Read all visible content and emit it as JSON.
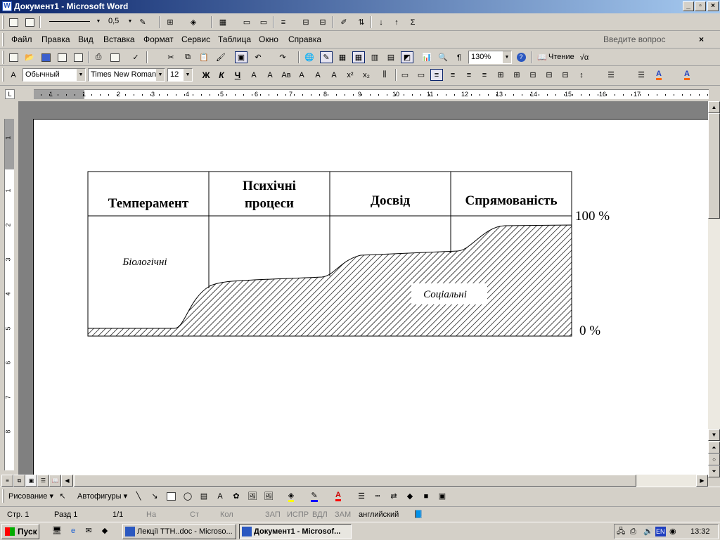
{
  "window": {
    "title": "Документ1 - Microsoft Word"
  },
  "menubar": {
    "items": [
      "Файл",
      "Правка",
      "Вид",
      "Вставка",
      "Формат",
      "Сервис",
      "Таблица",
      "Окно",
      "Справка"
    ],
    "help_placeholder": "Введите вопрос"
  },
  "toolbar_top": {
    "line_weight": "0,5"
  },
  "toolbar_standard": {
    "zoom": "130%",
    "reading_label": "Чтение"
  },
  "toolbar_format": {
    "style": "Обычный",
    "font": "Times New Roman",
    "size": "12",
    "bold": "Ж",
    "italic": "К",
    "underline": "Ч"
  },
  "ruler": {
    "h_numbers": [
      "1",
      "1",
      "2",
      "3",
      "4",
      "5",
      "6",
      "7",
      "8",
      "9",
      "10",
      "11",
      "12",
      "13",
      "14",
      "15",
      "16",
      "17"
    ],
    "v_numbers": [
      "1",
      "1",
      "2",
      "3",
      "4",
      "5",
      "6",
      "7",
      "8"
    ]
  },
  "document": {
    "table_headers": [
      "Темперамент",
      "Психічні процеси",
      "Досвід",
      "Спрямованість"
    ],
    "label_bio": "Біологічні",
    "label_soc": "Соціальні",
    "pct_top": "100 %",
    "pct_bottom": "0 %"
  },
  "drawbar": {
    "drawing": "Рисование",
    "autoshapes": "Автофигуры"
  },
  "statusbar": {
    "page": "Стр. 1",
    "section": "Разд 1",
    "pages": "1/1",
    "at": "На",
    "line": "Ст",
    "col": "Кол",
    "rec": "ЗАП",
    "trk": "ИСПР",
    "ext": "ВДЛ",
    "ovr": "ЗАМ",
    "lang": "английский"
  },
  "taskbar": {
    "start": "Пуск",
    "tasks": [
      "Лекції ТТН..doc - Microso...",
      "Документ1 - Microsof..."
    ],
    "lang": "EN",
    "clock": "13:32"
  }
}
